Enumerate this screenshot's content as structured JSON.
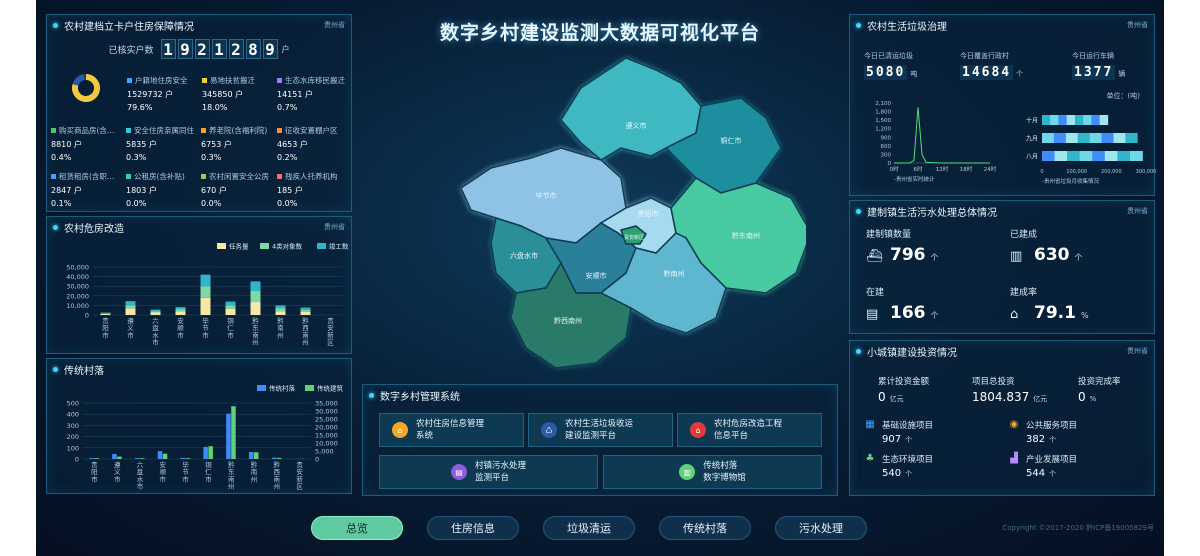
{
  "page": {
    "title": "数字乡村建设监测大数据可视化平台"
  },
  "housing": {
    "title": "农村建档立卡户住房保障情况",
    "region": "贵州省",
    "kpi_label": "已核实户数",
    "kpi_digits": [
      "1",
      "9",
      "2",
      "1",
      "2",
      "8",
      "9"
    ],
    "kpi_unit": "户",
    "donut": {
      "colors": [
        "#f5c842",
        "#2b5aa8",
        "#1a3d6e"
      ],
      "values": [
        79.6,
        18.0,
        2.4
      ]
    },
    "categories": [
      {
        "label": "户籍地住房安全",
        "value": "1529732 户",
        "pct": "79.6%",
        "color": "#3fa2ff"
      },
      {
        "label": "易地扶贫搬迁",
        "value": "345850 户",
        "pct": "18.0%",
        "color": "#f5c842"
      },
      {
        "label": "生态水库移民搬迁",
        "value": "14151 户",
        "pct": "0.7%",
        "color": "#9b7bff"
      },
      {
        "label": "购买商品房(含…",
        "value": "8810 户",
        "pct": "0.4%",
        "color": "#52c46a"
      },
      {
        "label": "安全住房亲属同住",
        "value": "5835 户",
        "pct": "0.3%",
        "color": "#35c6d9"
      },
      {
        "label": "养老院(含福利院)",
        "value": "6753 户",
        "pct": "0.3%",
        "color": "#f5a623"
      },
      {
        "label": "征收安置棚户区",
        "value": "4653 户",
        "pct": "0.2%",
        "color": "#ff8c3a"
      },
      {
        "label": "租赁租房(含职…",
        "value": "2847 户",
        "pct": "0.1%",
        "color": "#3fa2ff"
      },
      {
        "label": "公租房(含补贴)",
        "value": "1803 户",
        "pct": "0.0%",
        "color": "#2ed1b0"
      },
      {
        "label": "农村闲置安全公房",
        "value": "670 户",
        "pct": "0.0%",
        "color": "#8fd14f"
      },
      {
        "label": "残疾人托养机构",
        "value": "185 户",
        "pct": "0.0%",
        "color": "#ff6b6b"
      }
    ]
  },
  "dangerous": {
    "title": "农村危房改造",
    "region": "贵州省",
    "chart_data": {
      "type": "bar",
      "stacked": true,
      "categories": [
        "贵阳市",
        "遵义市",
        "六盘水市",
        "安顺市",
        "毕节市",
        "铜仁市",
        "黔东南州",
        "黔南州",
        "黔西南州",
        "贵安新区"
      ],
      "series": [
        {
          "name": "任务量",
          "color": "#f6e7a4",
          "values": [
            1200,
            7000,
            2600,
            3600,
            18000,
            6600,
            13500,
            4000,
            3200,
            0
          ]
        },
        {
          "name": "4类对象数",
          "color": "#7fd9a6",
          "values": [
            600,
            3000,
            1400,
            2600,
            12000,
            3400,
            11500,
            3200,
            2100,
            0
          ]
        },
        {
          "name": "竣工数",
          "color": "#2fb7c9",
          "values": [
            700,
            4400,
            1600,
            2000,
            12000,
            4000,
            10000,
            2800,
            2400,
            0
          ]
        }
      ],
      "ylim": [
        0,
        50000
      ],
      "yticks": [
        "50,000",
        "40,000",
        "30,000",
        "20,000",
        "10,000",
        "0"
      ],
      "legend": "top-right"
    }
  },
  "villages": {
    "title": "传统村落",
    "chart_data": {
      "type": "bar",
      "categories": [
        "贵阳市",
        "遵义市",
        "六盘水市",
        "安顺市",
        "毕节市",
        "铜仁市",
        "黔东南州",
        "黔南州",
        "黔西南州",
        "贵安新区"
      ],
      "series": [
        {
          "name": "传统村落",
          "color": "#3f8cff",
          "axis": "left",
          "values": [
            8,
            45,
            8,
            70,
            10,
            108,
            405,
            62,
            12,
            2
          ]
        },
        {
          "name": "传统建筑",
          "color": "#5fd17a",
          "axis": "right",
          "values": [
            500,
            1500,
            500,
            3300,
            500,
            8000,
            33000,
            4200,
            700,
            100
          ]
        }
      ],
      "ylim_left": [
        0,
        500
      ],
      "ylim_right": [
        0,
        35000
      ],
      "yticks_left": [
        "500",
        "400",
        "300",
        "200",
        "100",
        "0"
      ],
      "yticks_right": [
        "35,000",
        "30,000",
        "25,000",
        "20,000",
        "15,000",
        "10,000",
        "5,000",
        "0"
      ],
      "legend": "top-right"
    }
  },
  "garbage": {
    "title": "农村生活垃圾治理",
    "region": "贵州省",
    "stats": [
      {
        "label": "今日已清运垃圾",
        "value": "5080",
        "unit": "吨"
      },
      {
        "label": "今日覆盖行政村",
        "value": "14684",
        "unit": "个"
      },
      {
        "label": "今日运行车辆",
        "value": "1377",
        "unit": "辆"
      }
    ],
    "unit_note": "单位：(吨)",
    "line_chart": {
      "type": "line",
      "caption": "-贵州省实时统计",
      "x": [
        "0时",
        "6时",
        "12时",
        "18时",
        "24时"
      ],
      "yticks": [
        "2,100",
        "1,800",
        "1,500",
        "1,200",
        "900",
        "600",
        "300",
        "0"
      ],
      "ylim": [
        0,
        2100
      ],
      "points": [
        [
          0,
          0
        ],
        [
          4,
          0
        ],
        [
          5,
          100
        ],
        [
          6,
          1950
        ],
        [
          7,
          300
        ],
        [
          8,
          20
        ],
        [
          12,
          0
        ],
        [
          24,
          0
        ]
      ]
    },
    "bar_chart": {
      "type": "bar",
      "caption": "-贵州省垃圾月收集情况",
      "categories": [
        "十月",
        "九月",
        "八月"
      ],
      "xticks": [
        "0",
        "100,000",
        "200,000",
        "300,000"
      ],
      "xlim": [
        0,
        300000
      ],
      "values": [
        190000,
        275000,
        290000
      ]
    }
  },
  "sewage": {
    "title": "建制镇生活污水处理总体情况",
    "region": "贵州省",
    "items": [
      {
        "label": "建制镇数量",
        "value": "796",
        "unit": "个",
        "icon": "boat-icon"
      },
      {
        "label": "已建成",
        "value": "630",
        "unit": "个",
        "icon": "factory-icon"
      },
      {
        "label": "在建",
        "value": "166",
        "unit": "个",
        "icon": "building-icon"
      },
      {
        "label": "建成率",
        "value": "79.1",
        "unit": "%",
        "icon": "house-percent-icon"
      }
    ]
  },
  "investment": {
    "title": "小城镇建设投资情况",
    "region": "贵州省",
    "top": [
      {
        "label": "累计投资金额",
        "value": "0",
        "unit": "亿元"
      },
      {
        "label": "项目总投资",
        "value": "1804.837",
        "unit": "亿元"
      },
      {
        "label": "投资完成率",
        "value": "0",
        "unit": "%"
      }
    ],
    "projects": [
      {
        "label": "基础设施项目",
        "value": "907",
        "unit": "个",
        "icon": "infrastructure-icon",
        "color": "#3fa2ff"
      },
      {
        "label": "公共服务项目",
        "value": "382",
        "unit": "个",
        "icon": "public-service-icon",
        "color": "#f5a623"
      },
      {
        "label": "生态环境项目",
        "value": "540",
        "unit": "个",
        "icon": "tree-icon",
        "color": "#5fd17a"
      },
      {
        "label": "产业发展项目",
        "value": "544",
        "unit": "个",
        "icon": "industry-icon",
        "color": "#b58cff"
      }
    ]
  },
  "map": {
    "regions": [
      {
        "name": "遵义市",
        "color": "#3fb8c2"
      },
      {
        "name": "铜仁市",
        "color": "#1f8e9d"
      },
      {
        "name": "毕节市",
        "color": "#8ec3e6"
      },
      {
        "name": "贵阳市",
        "color": "#a7d9ef"
      },
      {
        "name": "黔东南州",
        "color": "#47c9a1"
      },
      {
        "name": "六盘水市",
        "color": "#2b8f98"
      },
      {
        "name": "安顺市",
        "color": "#2a7f99"
      },
      {
        "name": "黔南州",
        "color": "#5fb7cf"
      },
      {
        "name": "黔西南州",
        "color": "#2c7a6a"
      },
      {
        "name": "贵安新区",
        "color": "#2fa06e"
      }
    ]
  },
  "management": {
    "title": "数字乡村管理系统",
    "systems": [
      {
        "label": "农村住房信息管理\n系统",
        "icon": "house-icon",
        "color": "#f5a623"
      },
      {
        "label": "农村生活垃圾收运\n建设监测平台",
        "icon": "recycle-icon",
        "color": "#2b5aa8"
      },
      {
        "label": "农村危房改造工程\n信息平台",
        "icon": "house-alert-icon",
        "color": "#e03a3a"
      },
      {
        "label": "村镇污水处理\n监测平台",
        "icon": "water-plant-icon",
        "color": "#8a5cd6"
      },
      {
        "label": "传统村落\n数字博物馆",
        "icon": "museum-icon",
        "color": "#5fd17a"
      }
    ]
  },
  "nav": {
    "items": [
      "总览",
      "住房信息",
      "垃圾清运",
      "传统村落",
      "污水处理"
    ],
    "active": 0
  },
  "footer": {
    "copyright": "Copyright ©2017-2020 黔ICP备19005829号"
  }
}
